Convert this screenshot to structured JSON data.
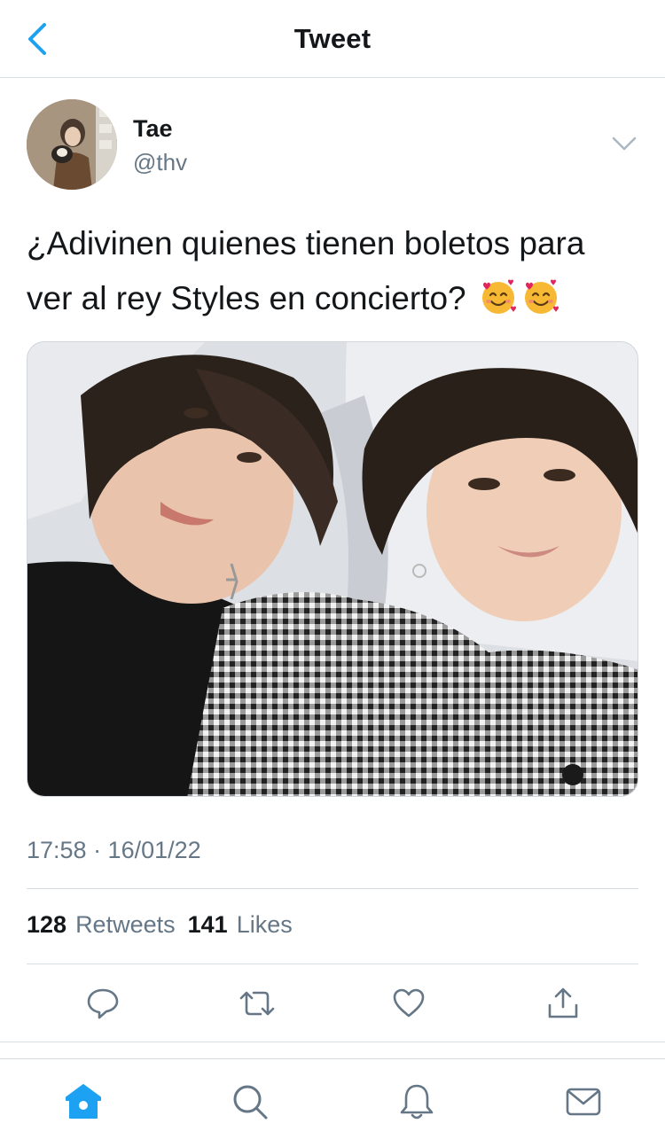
{
  "header": {
    "title": "Tweet",
    "back_icon": "chevron-left-icon"
  },
  "author": {
    "name": "Tae",
    "handle": "@thv",
    "more_icon": "chevron-down-icon"
  },
  "tweet": {
    "text": "¿Adivinen quienes tienen boletos para ver al rey Styles en concierto?",
    "emoji": [
      "smiling-face-with-hearts-emoji",
      "smiling-face-with-hearts-emoji"
    ],
    "timestamp": "17:58 · 16/01/22"
  },
  "stats": {
    "retweets_count": "128",
    "retweets_label": "Retweets",
    "likes_count": "141",
    "likes_label": "Likes"
  },
  "actions": [
    "reply-icon",
    "retweet-icon",
    "like-icon",
    "share-icon"
  ],
  "tabbar": [
    "home-icon",
    "search-icon",
    "notifications-icon",
    "messages-icon"
  ],
  "colors": {
    "accent": "#1da1f2",
    "text": "#14171a",
    "secondary": "#657786",
    "divider": "#d8dde2"
  }
}
